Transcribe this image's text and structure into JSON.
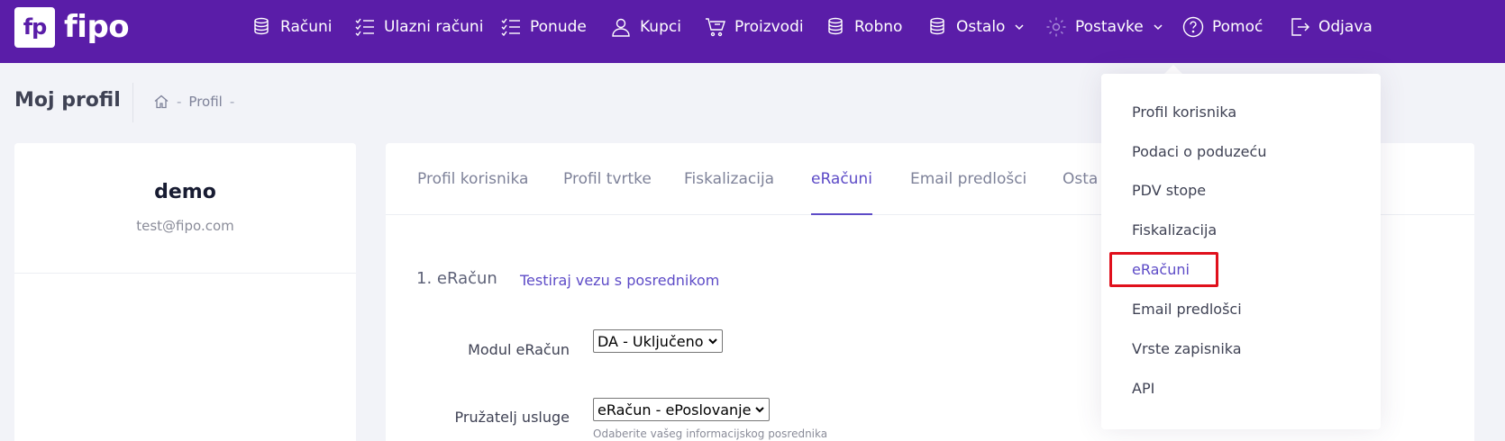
{
  "brand": {
    "logo_mark": "fp",
    "name": "fipo"
  },
  "nav": [
    {
      "label": "Računi",
      "icon": "coins-icon"
    },
    {
      "label": "Ulazni računi",
      "icon": "checklist-icon"
    },
    {
      "label": "Ponude",
      "icon": "checklist-icon"
    },
    {
      "label": "Kupci",
      "icon": "user-icon"
    },
    {
      "label": "Proizvodi",
      "icon": "cart-icon"
    },
    {
      "label": "Robno",
      "icon": "coins-icon"
    },
    {
      "label": "Ostalo",
      "icon": "coins-icon"
    },
    {
      "label": "Postavke",
      "icon": "gear-icon"
    },
    {
      "label": "Pomoć",
      "icon": "help-circle-icon"
    },
    {
      "label": "Odjava",
      "icon": "logout-icon"
    }
  ],
  "header": {
    "title": "Moj profil",
    "breadcrumb": [
      "Profil"
    ]
  },
  "profile": {
    "name": "demo",
    "email": "test@fipo.com"
  },
  "tabs": [
    {
      "label": "Profil korisnika"
    },
    {
      "label": "Profil tvrtke"
    },
    {
      "label": "Fiskalizacija"
    },
    {
      "label": "eRačuni",
      "active": true
    },
    {
      "label": "Email predlošci"
    },
    {
      "label": "Osta"
    }
  ],
  "section": {
    "title": "1. eRačun",
    "link": "Testiraj vezu s posrednikom"
  },
  "form": {
    "modul_label": "Modul eRačun",
    "modul_value": "DA - Uključeno",
    "provider_label": "Pružatelj usluge",
    "provider_value": "eRačun - ePoslovanje",
    "provider_help": "Odaberite vašeg informacijskog posrednika"
  },
  "settings_menu": [
    {
      "label": "Profil korisnika"
    },
    {
      "label": "Podaci o poduzeću"
    },
    {
      "label": "PDV stope"
    },
    {
      "label": "Fiskalizacija"
    },
    {
      "label": "eRačuni",
      "active": true
    },
    {
      "label": "Email predlošci"
    },
    {
      "label": "Vrste zapisnika"
    },
    {
      "label": "API"
    }
  ],
  "colors": {
    "nav_bg": "#5a1da8",
    "accent": "#5d4bc7",
    "highlight": "#e0101c"
  }
}
